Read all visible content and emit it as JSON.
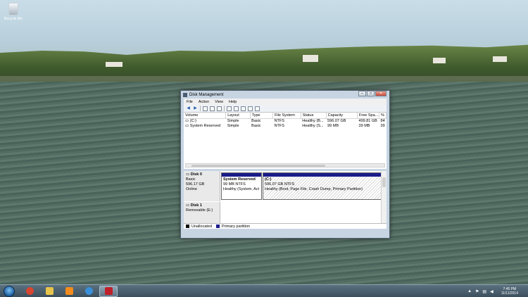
{
  "desktop": {
    "recycle_bin_label": "Recycle Bin"
  },
  "window": {
    "title": "Disk Management",
    "caption_buttons": {
      "minimize": "–",
      "maximize": "□",
      "close": "✕"
    },
    "menu": [
      "File",
      "Action",
      "View",
      "Help"
    ],
    "volumes": {
      "columns": [
        "Volume",
        "Layout",
        "Type",
        "File System",
        "Status",
        "Capacity",
        "Free Spa...",
        "%"
      ],
      "rows": [
        [
          "(C:)",
          "Simple",
          "Basic",
          "NTFS",
          "Healthy (B...",
          "596.07 GB",
          "499.81 GB",
          "84"
        ],
        [
          "System Reserved",
          "Simple",
          "Basic",
          "NTFS",
          "Healthy (S...",
          "99 MB",
          "39 MB",
          "39"
        ]
      ]
    },
    "disks": [
      {
        "name": "Disk 0",
        "type": "Basic",
        "size": "596.17 GB",
        "state": "Online",
        "partitions": [
          {
            "name": "System Reserved",
            "size": "99 MB NTFS",
            "status": "Healthy (System, Act"
          },
          {
            "name": "(C:)",
            "size": "596.07 GB NTFS",
            "status": "Healthy (Boot, Page File, Crash Dump, Primary Partition)"
          }
        ]
      },
      {
        "name": "Disk 1",
        "type": "Removable (E:)"
      }
    ],
    "legend": {
      "unallocated": "Unallocated",
      "primary": "Primary partition"
    }
  },
  "taskbar": {
    "apps": [
      {
        "icon": "chrome-icon",
        "color": "#d8452f"
      },
      {
        "icon": "explorer-icon",
        "color": "#e8c34a"
      },
      {
        "icon": "media-player-icon",
        "color": "#f28c1c"
      },
      {
        "icon": "ie-icon",
        "color": "#3a8fd8"
      },
      {
        "icon": "disk-management-icon",
        "color": "#c0202a"
      }
    ],
    "time": "7:45 PM",
    "date": "11/11/2014"
  },
  "colors": {
    "primary_partition": "#1b1b8c",
    "unallocated": "#111111"
  }
}
